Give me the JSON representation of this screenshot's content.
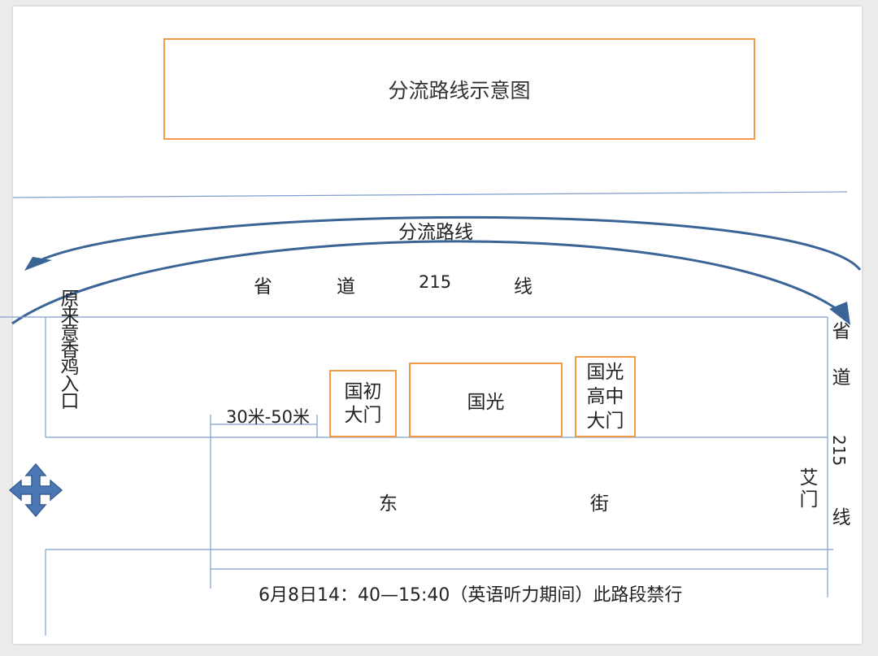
{
  "title": "分流路线示意图",
  "diversion_label": "分流路线",
  "top_road": {
    "parts": [
      "省",
      "道",
      "215",
      "线"
    ]
  },
  "left_entrance": "原来意香鸡入口",
  "distance_label": "30米-50米",
  "gates": {
    "guochu": "国初大门",
    "guoguang": "国光",
    "guoguang_high": "国光高中大门"
  },
  "street": {
    "parts": [
      "东",
      "街"
    ]
  },
  "ai_gate": "艾门",
  "right_road": {
    "top": "省道",
    "num": "215",
    "end": "线"
  },
  "notice": "6月8日14：40—15:40（英语听力期间）此路段禁行",
  "colors": {
    "box_border": "#f39a45",
    "arrow": "#3b6496",
    "line": "#7e9fcf"
  },
  "icons": [
    "move-cross-icon"
  ]
}
